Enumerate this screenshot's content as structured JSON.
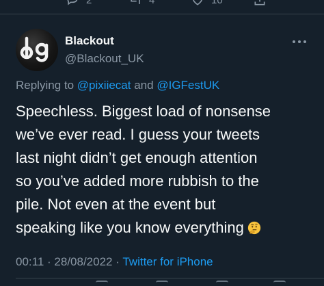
{
  "top_actions": {
    "reply_count": "2",
    "retweet_count": "4",
    "like_count": "10"
  },
  "author": {
    "display_name": "Blackout",
    "handle": "@Blackout_UK",
    "avatar_logo": "bg"
  },
  "reply": {
    "prefix": "Replying to",
    "mention_1": "@pixiiecat",
    "conjunction": "and",
    "mention_2": "@IGFestUK"
  },
  "tweet": {
    "lines": [
      "Speechless. Biggest load of nonsense",
      "we’ve ever read. I guess your tweets",
      "last night didn’t get enough attention",
      "so you’ve added more rubbish to the",
      "pile. Not even at the event but",
      "speaking like you know everything"
    ],
    "emoji": "thinking-face"
  },
  "meta": {
    "time": "00:11",
    "separator_1": "·",
    "date": "28/08/2022",
    "separator_2": "·",
    "source": "Twitter for iPhone"
  },
  "colors": {
    "background": "#15202b",
    "text_primary": "#f7f9f9",
    "text_secondary": "#8b98a5",
    "accent": "#1d9bf0"
  }
}
